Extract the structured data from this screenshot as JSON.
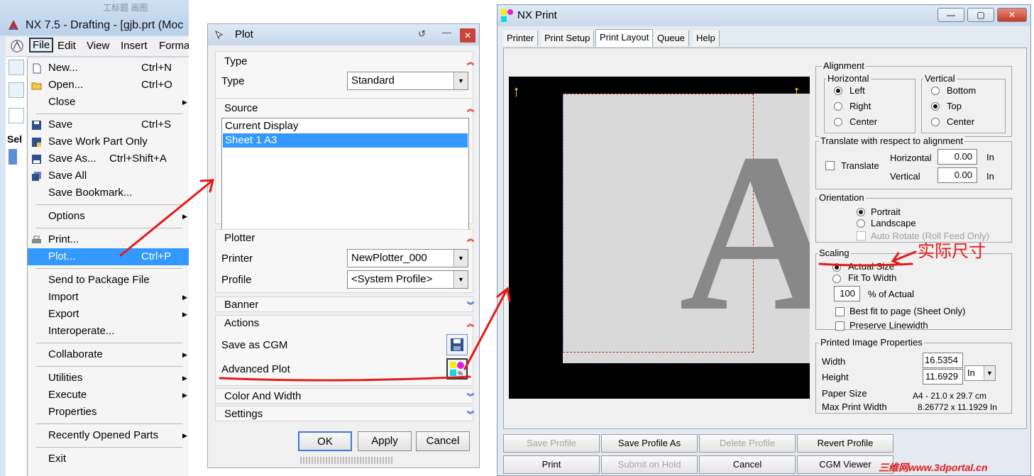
{
  "nx_window": {
    "faint_tabs": "工标题 画图",
    "title": "NX 7.5 - Drafting - [gjb.prt (Moc",
    "selection_abbr": "Sel",
    "menubar": [
      "File",
      "Edit",
      "View",
      "Insert",
      "Forma"
    ],
    "file_menu": [
      {
        "label": "New...",
        "shortcut": "Ctrl+N",
        "icon": "new-file-icon"
      },
      {
        "label": "Open...",
        "shortcut": "Ctrl+O",
        "icon": "open-folder-icon"
      },
      {
        "label": "Close",
        "submenu": true
      },
      {
        "label": "Save",
        "shortcut": "Ctrl+S",
        "icon": "save-icon"
      },
      {
        "label": "Save Work Part Only",
        "icon": "save-work-part-icon"
      },
      {
        "label": "Save As...",
        "shortcut": "Ctrl+Shift+A",
        "icon": "save-as-icon"
      },
      {
        "label": "Save All",
        "icon": "save-all-icon"
      },
      {
        "label": "Save Bookmark..."
      },
      {
        "label": "Options",
        "submenu": true
      },
      {
        "label": "Print...",
        "icon": "print-icon"
      },
      {
        "label": "Plot...",
        "shortcut": "Ctrl+P",
        "highlighted": true
      },
      {
        "label": "Send to Package File"
      },
      {
        "label": "Import",
        "submenu": true
      },
      {
        "label": "Export",
        "submenu": true
      },
      {
        "label": "Interoperate..."
      },
      {
        "label": "Collaborate",
        "submenu": true
      },
      {
        "label": "Utilities",
        "submenu": true
      },
      {
        "label": "Execute",
        "submenu": true
      },
      {
        "label": "Properties"
      },
      {
        "label": "Recently Opened Parts",
        "submenu": true
      },
      {
        "label": "Exit"
      }
    ]
  },
  "plot_dialog": {
    "title": "Plot",
    "type_group": {
      "header": "Type",
      "type_label": "Type",
      "type_value": "Standard"
    },
    "source_group": {
      "header": "Source",
      "items": [
        "Current Display",
        "Sheet 1  A3"
      ],
      "selected_index": 1
    },
    "plotter_group": {
      "header": "Plotter",
      "printer_label": "Printer",
      "printer_value": "NewPlotter_000",
      "profile_label": "Profile",
      "profile_value": "<System Profile>"
    },
    "banner_header": "Banner",
    "actions_group": {
      "header": "Actions",
      "save_cgm_label": "Save as CGM",
      "advanced_plot_label": "Advanced Plot"
    },
    "color_width_header": "Color And Width",
    "settings_header": "Settings",
    "buttons": {
      "ok": "OK",
      "apply": "Apply",
      "cancel": "Cancel"
    }
  },
  "print_window": {
    "title": "NX Print",
    "tabs": [
      "Printer",
      "Print Setup",
      "Print Layout",
      "Queue",
      "Help"
    ],
    "active_tab": "Print Layout",
    "preview_letter": "A",
    "alignment": {
      "legend": "Alignment",
      "horizontal_legend": "Horizontal",
      "horizontal_options": [
        "Left",
        "Right",
        "Center"
      ],
      "horizontal_selected": "Left",
      "vertical_legend": "Vertical",
      "vertical_options": [
        "Bottom",
        "Top",
        "Center"
      ],
      "vertical_selected": "Top"
    },
    "translate": {
      "legend": "Translate with respect to alignment",
      "checkbox_label": "Translate",
      "horizontal_label": "Horizontal",
      "horizontal_value": "0.00",
      "vertical_label": "Vertical",
      "vertical_value": "0.00",
      "unit": "In"
    },
    "orientation": {
      "legend": "Orientation",
      "portrait": "Portrait",
      "landscape": "Landscape",
      "auto_rotate": "Auto Rotate (Roll Feed Only)",
      "selected": "Portrait"
    },
    "scaling": {
      "legend": "Scaling",
      "actual_size": "Actual Size",
      "fit_to_width": "Fit To Width",
      "percent_value": "100",
      "percent_label": "% of Actual",
      "best_fit": "Best fit to page (Sheet Only)",
      "preserve_linewidth": "Preserve Linewidth",
      "selected": "Actual Size"
    },
    "printed_image": {
      "legend": "Printed Image Properties",
      "width_label": "Width",
      "width_value": "16.5354",
      "height_label": "Height",
      "height_value": "11.6929",
      "unit_value": "In",
      "paper_size_label": "Paper Size",
      "paper_size_value": "A4 - 21.0 x 29.7 cm",
      "max_print_width_label": "Max Print Width",
      "max_print_width_value": "8.26772 x 11.1929 In"
    },
    "bottom_buttons": {
      "save_profile": "Save Profile",
      "save_profile_as": "Save Profile As",
      "delete_profile": "Delete Profile",
      "revert_profile": "Revert Profile",
      "print": "Print",
      "submit_on_hold": "Submit on Hold",
      "cancel": "Cancel",
      "cgm_viewer": "CGM Viewer"
    }
  },
  "annotation": {
    "text": "实际尺寸",
    "color": "#e51919"
  },
  "watermark": "三维网www.3dportal.cn",
  "colors": {
    "highlight": "#3399ff",
    "annotation_red": "#e51919",
    "preview_bg": "#000000",
    "yellow_arrow": "#ffe600"
  }
}
